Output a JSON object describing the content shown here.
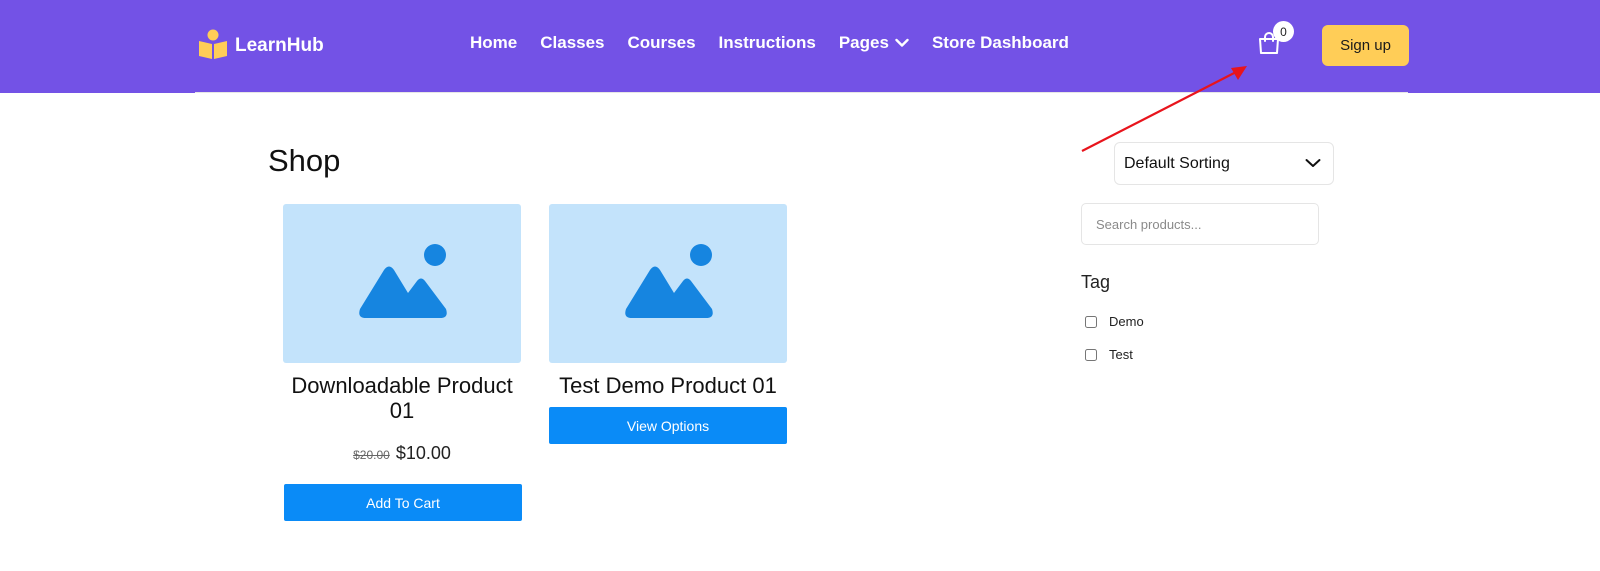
{
  "brand": {
    "name": "LearnHub",
    "logo_icon": "book-reader-icon",
    "logo_color": "#ffcd57"
  },
  "header": {
    "background": "#7352e6"
  },
  "nav": {
    "items": [
      {
        "label": "Home"
      },
      {
        "label": "Classes"
      },
      {
        "label": "Courses"
      },
      {
        "label": "Instructions"
      },
      {
        "label": "Pages",
        "has_dropdown": true
      },
      {
        "label": "Store Dashboard"
      }
    ]
  },
  "cart": {
    "count": "0",
    "icon": "shopping-bag-icon"
  },
  "signup": {
    "label": "Sign up",
    "color": "#ffcd57"
  },
  "shop": {
    "title": "Shop",
    "products": [
      {
        "title": "Downloadable Product 01",
        "price_old": "$20.00",
        "price_new": "$10.00",
        "button": "Add To Cart"
      },
      {
        "title": "Test Demo Product 01",
        "button": "View Options"
      }
    ],
    "button_color": "#0a8bf7",
    "placeholder_bg": "#c3e3fb",
    "placeholder_fg": "#1685e0"
  },
  "sidebar": {
    "sorting": {
      "selected": "Default Sorting"
    },
    "search": {
      "placeholder": "Search products..."
    },
    "tag": {
      "heading": "Tag",
      "options": [
        {
          "label": "Demo"
        },
        {
          "label": "Test"
        }
      ]
    }
  },
  "annotation": {
    "color": "#e8141c"
  }
}
